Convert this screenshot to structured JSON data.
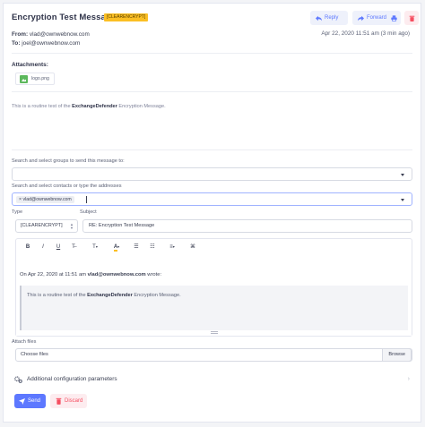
{
  "message": {
    "subject": "Encryption Test Message",
    "badge": "[CLEARENCRYPT]",
    "from_label": "From:",
    "from_value": "vlad@ownwebnow.com",
    "to_label": "To:",
    "to_value": "joel@ownwebnow.com",
    "date": "Apr 22, 2020 11:51 am (3 min ago)",
    "body_prefix": "This is a routine test of the ",
    "body_bold": "ExchangeDefender",
    "body_suffix": " Encryption Message."
  },
  "actions": {
    "reply": "Reply",
    "forward": "Forward"
  },
  "attachments": {
    "title": "Attachments:",
    "files": [
      "logo.png"
    ]
  },
  "compose": {
    "groups_label": "Search and select groups to send this message to:",
    "contacts_label": "Search and select contacts or type the addresses",
    "contact_tag": "× vlad@ownwebnow.com",
    "type_label": "Type",
    "type_value": "[CLEARENCRYPT]",
    "subject_label": "Subject",
    "subject_value": "RE: Encryption Test Message",
    "quote_head_prefix": "On Apr 22, 2020 at 11:51 am ",
    "quote_head_bold": "vlad@ownwebnow.com",
    "quote_head_suffix": " wrote:",
    "quote_prefix": "This is a routine test of the ",
    "quote_bold": "ExchangeDefender",
    "quote_suffix": " Encryption Message.",
    "attach_label": "Attach files",
    "file_placeholder": "Choose files",
    "browse": "Browse",
    "additional": "Additional configuration parameters",
    "send": "Send",
    "discard": "Discard"
  },
  "toolbar": {
    "bold": "B",
    "italic": "I",
    "underline": "U",
    "clear": "T̶",
    "font": "T",
    "color": "A",
    "ul": "☰",
    "ol": "☷",
    "align": "≡",
    "link": "⌘"
  },
  "colors": {
    "accent": "#5d78ff",
    "danger": "#f64e60",
    "badge": "#fbbf24"
  }
}
